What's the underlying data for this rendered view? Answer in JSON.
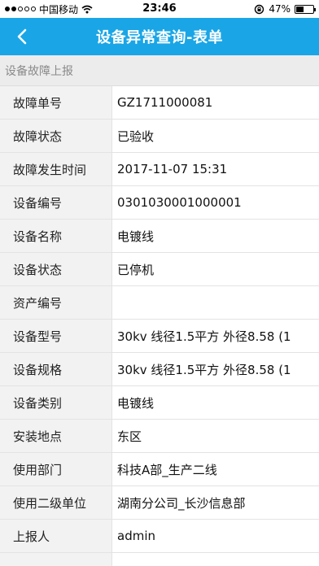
{
  "status_bar": {
    "carrier": "中国移动",
    "time": "23:46",
    "battery": "47%",
    "battery_level": 0.47,
    "icons": [
      "signal-dots-icon",
      "wifi-icon",
      "rotation-lock-icon",
      "battery-icon"
    ]
  },
  "nav": {
    "back_icon": "chevron-left-icon",
    "title": "设备异常查询-表单"
  },
  "section": {
    "title": "设备故障上报"
  },
  "fields": [
    {
      "label": "故障单号",
      "value": "GZ1711000081"
    },
    {
      "label": "故障状态",
      "value": "已验收"
    },
    {
      "label": "故障发生时间",
      "value": "2017-11-07 15:31"
    },
    {
      "label": "设备编号",
      "value": "0301030001000001"
    },
    {
      "label": "设备名称",
      "value": "电镀线"
    },
    {
      "label": "设备状态",
      "value": "已停机"
    },
    {
      "label": "资产编号",
      "value": ""
    },
    {
      "label": "设备型号",
      "value": "30kv  线径1.5平方 外径8.58  (1"
    },
    {
      "label": "设备规格",
      "value": "30kv  线径1.5平方 外径8.58  (1"
    },
    {
      "label": "设备类别",
      "value": "电镀线"
    },
    {
      "label": "安装地点",
      "value": "东区"
    },
    {
      "label": "使用部门",
      "value": "科技A部_生产二线"
    },
    {
      "label": "使用二级单位",
      "value": "湖南分公司_长沙信息部"
    },
    {
      "label": "上报人",
      "value": "admin"
    },
    {
      "label": "",
      "value": ""
    }
  ],
  "colors": {
    "nav_bg": "#1aa6e6",
    "section_bg": "#ececec",
    "label_bg": "#f2f2f2"
  }
}
